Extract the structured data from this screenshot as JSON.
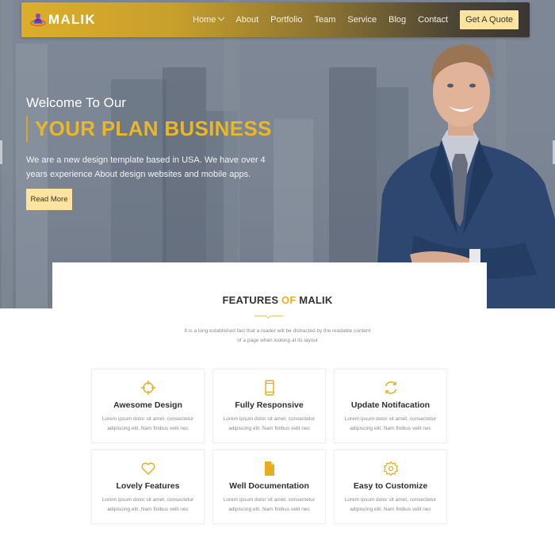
{
  "brand": {
    "name": "MALIK",
    "accent_color": "#e6ad23",
    "button_color": "#fbe3a0",
    "logo_icon": "person-globe-logo"
  },
  "nav": {
    "items": [
      {
        "label": "Home",
        "has_dropdown": true
      },
      {
        "label": "About"
      },
      {
        "label": "Portfolio"
      },
      {
        "label": "Team"
      },
      {
        "label": "Service"
      },
      {
        "label": "Blog"
      },
      {
        "label": "Contact"
      }
    ],
    "cta_label": "Get A Quote"
  },
  "hero": {
    "welcome": "Welcome To Our",
    "headline": "YOUR PLAN BUSINESS",
    "description": "We are a new design template based in USA. We have over 4 years experience About design websites and mobile apps.",
    "button_label": "Read More",
    "image": "businessman-arms-crossed"
  },
  "features": {
    "title_part1": "FEATURES ",
    "title_accent": "OF",
    "title_part2": " MALIK",
    "subtitle_line1": "It is a long established fact that a reader will be distracted by the readable content",
    "subtitle_line2": "of a page when looking at its layout",
    "cards": [
      {
        "icon": "crosshair-icon",
        "title": "Awesome Design",
        "line1": "Lorem ipsum dolor sit amet, consectetur",
        "line2": "adipiscing elit. Nam finibus velit nec"
      },
      {
        "icon": "mobile-icon",
        "title": "Fully Responsive",
        "line1": "Lorem ipsum dolor sit amet, consectetur",
        "line2": "adipiscing elit. Nam finibus velit nec"
      },
      {
        "icon": "refresh-icon",
        "title": "Update Notifacation",
        "line1": "Lorem ipsum dolor sit amet, consectetur",
        "line2": "adipiscing elit. Nam finibus velit nec"
      },
      {
        "icon": "heart-icon",
        "title": "Lovely Features",
        "line1": "Lorem ipsum dolor sit amet, consectetur",
        "line2": "adipiscing elit. Nam finibus velit nec"
      },
      {
        "icon": "document-icon",
        "title": "Well Documentation",
        "line1": "Lorem ipsum dolor sit amet, consectetur",
        "line2": "adipiscing elit. Nam finibus velit nec"
      },
      {
        "icon": "gear-icon",
        "title": "Easy to Customize",
        "line1": "Lorem ipsum dolor sit amet, consectetur",
        "line2": "adipiscing elit. Nam finibus velit nec"
      }
    ]
  }
}
